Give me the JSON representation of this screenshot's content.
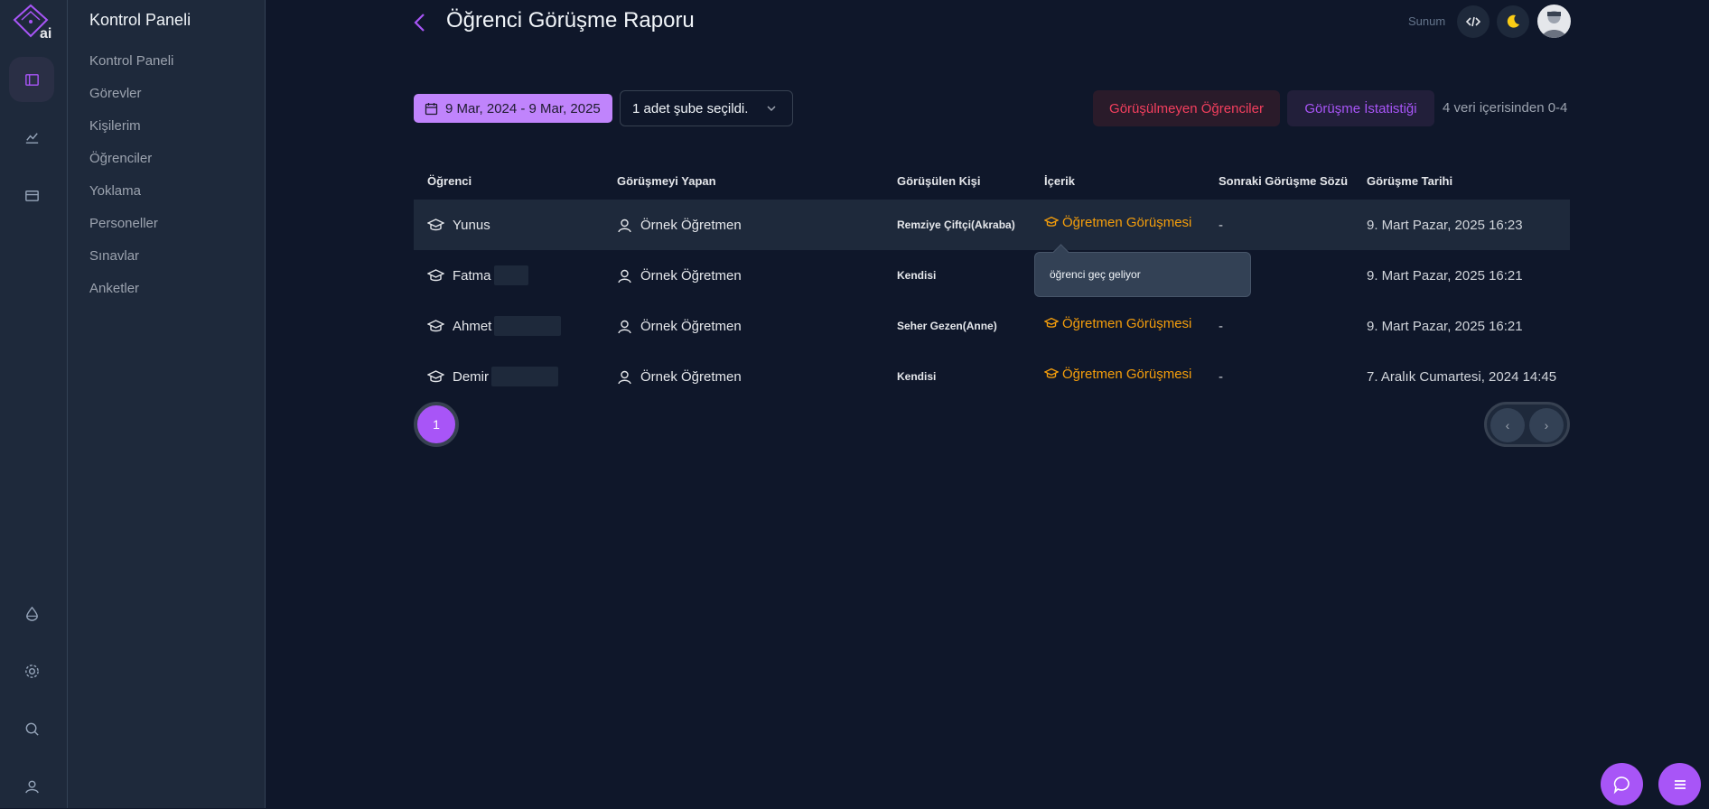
{
  "sidebar": {
    "title": "Kontrol Paneli",
    "items": [
      {
        "label": "Kontrol Paneli"
      },
      {
        "label": "Görevler"
      },
      {
        "label": "Kişilerim"
      },
      {
        "label": "Öğrenciler"
      },
      {
        "label": "Yoklama"
      },
      {
        "label": "Personeller"
      },
      {
        "label": "Sınavlar"
      },
      {
        "label": "Anketler"
      }
    ]
  },
  "header": {
    "title": "Öğrenci Görüşme Raporu",
    "sunum_label": "Sunum"
  },
  "filters": {
    "date_range": "9 Mar, 2024 - 9 Mar, 2025",
    "branch_select": "1 adet şube seçildi."
  },
  "actions": {
    "unmet_students": "Görüşülmeyen Öğrenciler",
    "stats": "Görüşme İstatistiği",
    "count": "4 veri içerisinden 0-4"
  },
  "table": {
    "headers": [
      "Öğrenci",
      "Görüşmeyi Yapan",
      "Görüşülen Kişi",
      "İçerik",
      "Sonraki Görüşme Sözü",
      "Görüşme Tarihi"
    ],
    "rows": [
      {
        "student": "Yunus",
        "interviewer": "Örnek Öğretmen",
        "person": "Remziye Çiftçi(Akraba)",
        "content": "Öğretmen Görüşmesi",
        "next": "-",
        "date": "9. Mart Pazar, 2025 16:23"
      },
      {
        "student": "Fatma",
        "interviewer": "Örnek Öğretmen",
        "person": "Kendisi",
        "content": "",
        "next": "",
        "date": "9. Mart Pazar, 2025 16:21"
      },
      {
        "student": "Ahmet",
        "interviewer": "Örnek Öğretmen",
        "person": "Seher Gezen(Anne)",
        "content": "Öğretmen Görüşmesi",
        "next": "-",
        "date": "9. Mart Pazar, 2025 16:21"
      },
      {
        "student": "Demir",
        "interviewer": "Örnek Öğretmen",
        "person": "Kendisi",
        "content": "Öğretmen Görüşmesi",
        "next": "-",
        "date": "7. Aralık Cumartesi, 2024 14:45"
      }
    ]
  },
  "tooltip": {
    "text": "öğrenci geç geliyor"
  },
  "pagination": {
    "current_page": "1",
    "prev": "‹",
    "next": "›"
  },
  "colors": {
    "accent": "#a855f7",
    "danger": "#f43f5e",
    "content": "#f59e0b"
  },
  "icons": {
    "rail": [
      "panel-icon",
      "chart-icon",
      "inbox-icon",
      "droplet-icon",
      "settings-icon",
      "search-icon",
      "user-icon"
    ],
    "student": "graduation-cap-icon",
    "teacher": "person-icon"
  }
}
